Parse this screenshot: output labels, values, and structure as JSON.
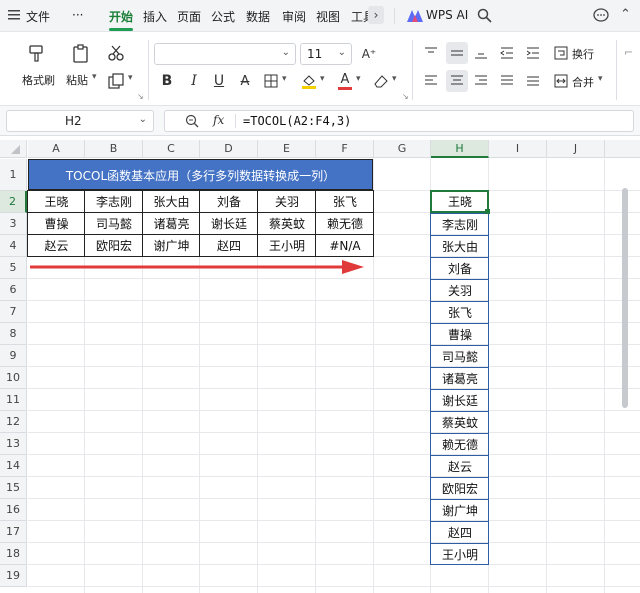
{
  "menu": {
    "file": "文件",
    "more": "···",
    "tabs": [
      "开始",
      "插入",
      "页面",
      "公式",
      "数据",
      "审阅",
      "视图",
      "工具"
    ],
    "wps_ai": "WPS AI"
  },
  "ribbon": {
    "format_painter": "格式刷",
    "paste": "粘贴",
    "font_size": "11",
    "bold": "B",
    "italic": "I",
    "underline": "U",
    "wrap": "换行",
    "merge": "合并"
  },
  "formula_bar": {
    "cell_ref": "H2",
    "fx": "fx",
    "formula": "=TOCOL(A2:F4,3)"
  },
  "grid": {
    "columns": [
      "A",
      "B",
      "C",
      "D",
      "E",
      "F",
      "G",
      "H",
      "I",
      "J"
    ],
    "rows": [
      "1",
      "2",
      "3",
      "4",
      "5",
      "6",
      "7",
      "8",
      "9",
      "10",
      "11",
      "12",
      "13",
      "14",
      "15",
      "16",
      "17",
      "18",
      "19"
    ],
    "title": "TOCOL函数基本应用（多行多列数据转换成一列）",
    "table": [
      [
        "王晓",
        "李志刚",
        "张大由",
        "刘备",
        "关羽",
        "张飞"
      ],
      [
        "曹操",
        "司马懿",
        "诸葛亮",
        "谢长廷",
        "蔡英蚊",
        "赖无德"
      ],
      [
        "赵云",
        "欧阳宏",
        "谢广坤",
        "赵四",
        "王小明",
        "#N/A"
      ]
    ],
    "result": [
      "王晓",
      "李志刚",
      "张大由",
      "刘备",
      "关羽",
      "张飞",
      "曹操",
      "司马懿",
      "诸葛亮",
      "谢长廷",
      "蔡英蚊",
      "赖无德",
      "赵云",
      "欧阳宏",
      "谢广坤",
      "赵四",
      "王小明"
    ]
  },
  "colors": {
    "title_bg": "#4472c4",
    "arrow": "#e03a3a",
    "active_tab": "#1a7f37",
    "selection": "#1f7a3c"
  }
}
